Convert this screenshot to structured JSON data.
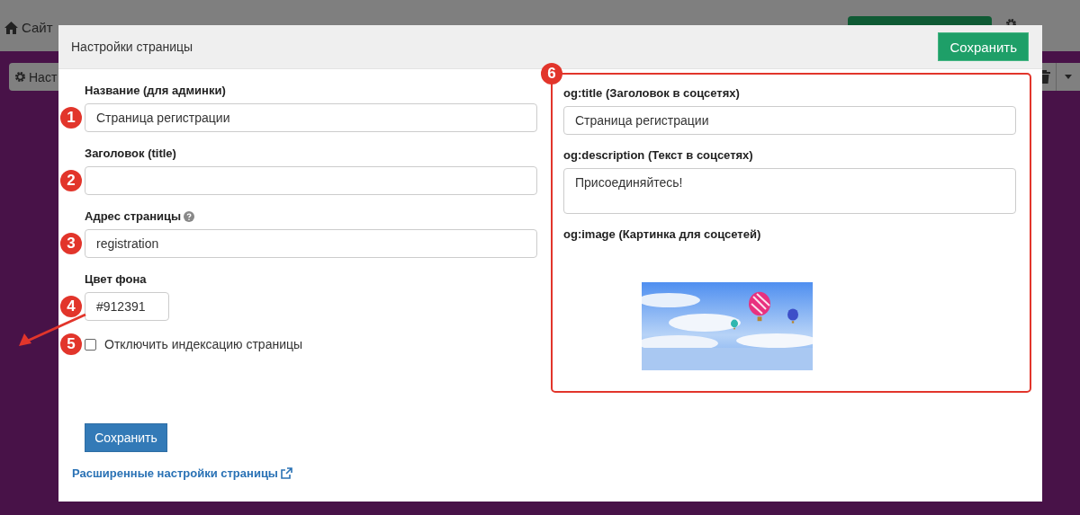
{
  "topbar": {
    "breadcrumb": "Сайт",
    "toolbar_button": "Наст"
  },
  "modal": {
    "title": "Настройки страницы",
    "save_button": "Сохранить",
    "fields": [
      {
        "marker": "1",
        "label": "Название (для админки)",
        "value": "Страница регистрации",
        "kind": "text"
      },
      {
        "marker": "2",
        "label": "Заголовок (title)",
        "kind": "text"
      },
      {
        "marker": "3",
        "label": "Адрес страницы",
        "help": true,
        "value": "registration",
        "kind": "text"
      },
      {
        "marker": "4",
        "label": "Цвет фона",
        "value": "#912391",
        "kind": "color"
      }
    ],
    "checkbox": {
      "marker": "5",
      "label": "Отключить индексацию страницы",
      "checked": false
    },
    "social": {
      "marker": "6",
      "fields": [
        {
          "label": "og:title (Заголовок в соцсетях)",
          "value": "Страница регистрации",
          "kind": "text"
        },
        {
          "label": "og:description (Текст в соцсетях)",
          "value": "Присоединяйтесь!",
          "kind": "textarea"
        },
        {
          "label": "og:image (Картинка для соцсетей)"
        }
      ]
    },
    "bottom_button": "Сохранить",
    "link": "Расширенные настройки страницы"
  }
}
